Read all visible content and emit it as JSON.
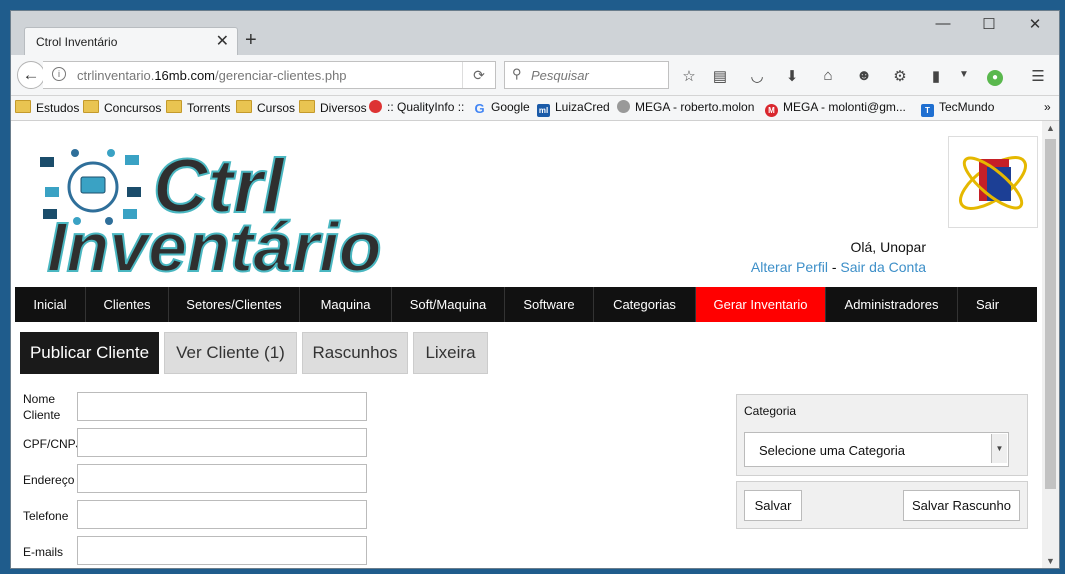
{
  "browser": {
    "tab_title": "Ctrol Inventário",
    "url_prefix": "ctrlinventario.",
    "url_domain": "16mb.com",
    "url_path": "/gerenciar-clientes.php",
    "search_placeholder": "Pesquisar"
  },
  "bookmarks": [
    {
      "label": "Estudos",
      "icon": "folder-icon"
    },
    {
      "label": "Concursos",
      "icon": "folder-icon"
    },
    {
      "label": "Torrents",
      "icon": "folder-icon"
    },
    {
      "label": "Cursos",
      "icon": "folder-icon"
    },
    {
      "label": "Diversos",
      "icon": "folder-icon"
    },
    {
      "label": ":: QualityInfo ::",
      "icon": "qualityinfo-icon"
    },
    {
      "label": "Google",
      "icon": "google-icon"
    },
    {
      "label": "LuizaCred",
      "icon": "luizacred-icon"
    },
    {
      "label": "MEGA - roberto.molon",
      "icon": "globe-icon"
    },
    {
      "label": "MEGA - molonti@gm...",
      "icon": "mega-icon"
    },
    {
      "label": "TecMundo",
      "icon": "tecmundo-icon"
    }
  ],
  "header": {
    "logo_word1": "Ctrl",
    "logo_word2": "Inventário",
    "greeting": "Olá, Unopar",
    "edit_profile": "Alterar Perfil",
    "separator": "-",
    "logout_link": "Sair da Conta"
  },
  "menu": [
    {
      "label": "Inicial"
    },
    {
      "label": "Clientes"
    },
    {
      "label": "Setores/Clientes"
    },
    {
      "label": "Maquina"
    },
    {
      "label": "Soft/Maquina"
    },
    {
      "label": "Software"
    },
    {
      "label": "Categorias"
    },
    {
      "label": "Gerar Inventario",
      "active": true
    },
    {
      "label": "Administradores"
    },
    {
      "label": "Sair"
    }
  ],
  "subtabs": [
    {
      "label": "Publicar Cliente",
      "active": true
    },
    {
      "label": "Ver Cliente (1)"
    },
    {
      "label": "Rascunhos"
    },
    {
      "label": "Lixeira"
    }
  ],
  "form": {
    "name_label": "Nome Cliente",
    "cpf_label": "CPF/CNPJ",
    "address_label": "Endereço",
    "phone_label": "Telefone",
    "email_label": "E-mails"
  },
  "sidebar": {
    "category_label": "Categoria",
    "category_select": "Selecione uma Categoria",
    "save_button": "Salvar",
    "save_draft_button": "Salvar Rascunho"
  },
  "colors": {
    "menu_bg": "#111111",
    "menu_active": "#ff0000",
    "link": "#3d8fc8",
    "logo_outline": "#4ab7c1"
  }
}
